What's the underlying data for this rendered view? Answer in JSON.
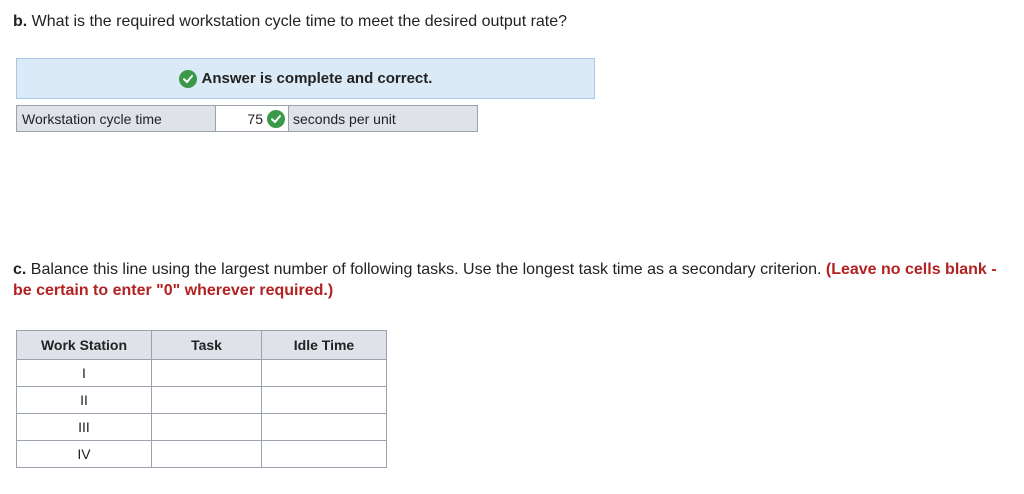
{
  "question_b": {
    "label": "b.",
    "text": "What is the required workstation cycle time to meet the desired output rate?"
  },
  "answer_banner": {
    "text": "Answer is complete and correct.",
    "icon": "check-circle-icon"
  },
  "answer_row": {
    "label": "Workstation cycle time",
    "value": "75",
    "unit": "seconds per unit"
  },
  "question_c": {
    "label": "c.",
    "text": "Balance this line using the largest number of following tasks. Use the longest task time as a secondary criterion.",
    "note": "(Leave no cells blank - be certain to enter \"0\" wherever required.)"
  },
  "table": {
    "headers": [
      "Work Station",
      "Task",
      "Idle Time"
    ],
    "rows": [
      {
        "station": "I",
        "task": "",
        "idle": ""
      },
      {
        "station": "II",
        "task": "",
        "idle": ""
      },
      {
        "station": "III",
        "task": "",
        "idle": ""
      },
      {
        "station": "IV",
        "task": "",
        "idle": ""
      }
    ]
  },
  "colors": {
    "check_green": "#3a9a4a",
    "banner_bg": "#dbeaf7",
    "note_red": "#b22222",
    "cell_gray": "#dfe2e8"
  }
}
